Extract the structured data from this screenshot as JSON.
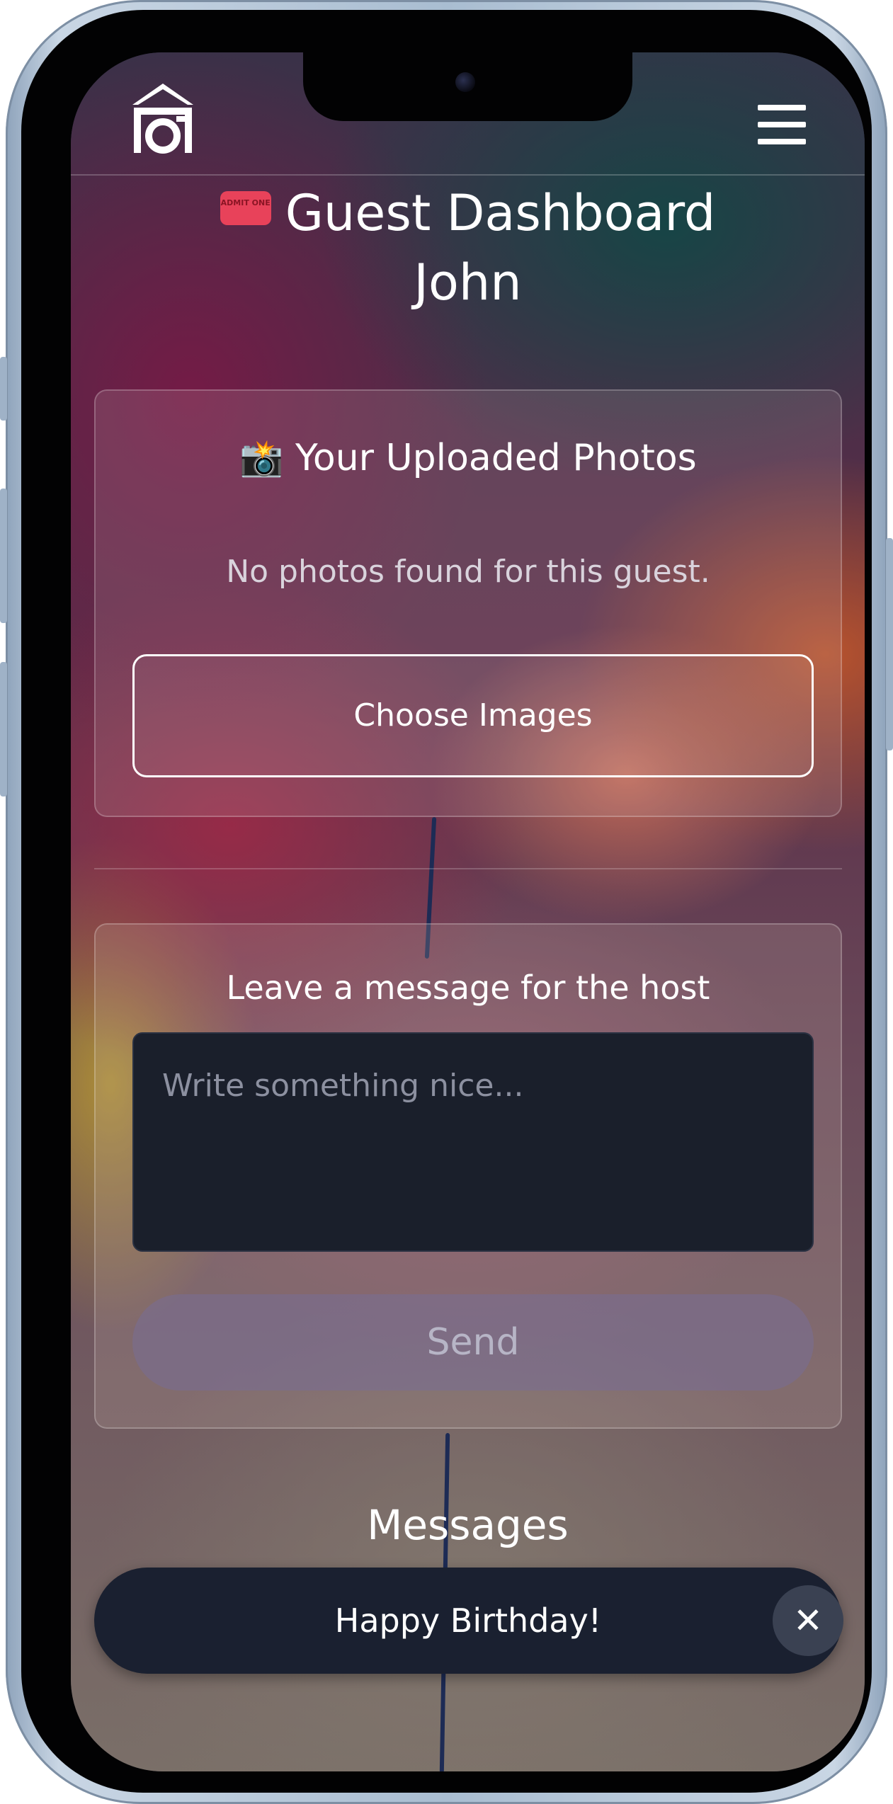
{
  "header": {
    "logo": "house-camera-logo",
    "menu_icon": "hamburger-menu-icon"
  },
  "page": {
    "title_icon": "ticket-icon",
    "ticket_text": "ADMIT ONE",
    "title_line1": "Guest Dashboard",
    "title_line2": "John"
  },
  "photos_card": {
    "title_icon": "camera-flash-icon",
    "title": "Your Uploaded Photos",
    "empty_text": "No photos found for this guest.",
    "choose_label": "Choose Images"
  },
  "message_card": {
    "title": "Leave a message for the host",
    "placeholder": "Write something nice...",
    "value": "",
    "send_label": "Send"
  },
  "messages": {
    "heading": "Messages",
    "items": [
      {
        "text": "Happy Birthday!"
      }
    ],
    "close_icon": "close-icon"
  }
}
